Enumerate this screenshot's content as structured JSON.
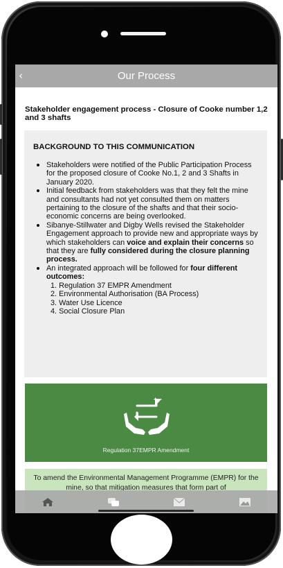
{
  "header": {
    "title": "Our Process",
    "back_glyph": "‹"
  },
  "page_heading": "Stakeholder engagement process - Closure of Cooke number 1,2 and 3 shafts",
  "background": {
    "title": "BACKGROUND TO THIS COMMUNICATION",
    "bullet1": "Stakeholders were notified of the Public Participation Process for the proposed closure of Cooke No.1, 2 and 3 Shafts in January 2020.",
    "bullet2": "Initial feedback from stakeholders was that they felt the mine and consultants had not yet consulted them on matters pertaining to the closure of the shafts and that their socio-economic concerns are being overlooked.",
    "bullet3": {
      "part1": "Sibanye-Stillwater and Digby Wells revised the Stakeholder Engagement approach to provide new and appropriate ways by which stakeholders can ",
      "bold1": "voice and explain their concerns",
      "part2": " so that they are ",
      "bold2": "fully considered during the closure planning process."
    },
    "bullet4": {
      "part1": "An integrated approach will be followed for ",
      "bold1": "four different outcomes:"
    },
    "outcomes": [
      "1.  Regulation 37 EMPR Amendment",
      "2.  Environmental Authorisation (BA Process)",
      "3.  Water Use Licence",
      "4.  Social Closure Plan"
    ]
  },
  "green_card": {
    "caption": "Regulation 37EMPR Amendment",
    "icon": "hands-exchange-icon"
  },
  "light_card": {
    "text": "To amend the Environmental Management Programme (EMPR) for the mine, so that mitigation measures that form part of"
  },
  "tabs": [
    {
      "icon": "home-icon"
    },
    {
      "icon": "chat-icon"
    },
    {
      "icon": "mail-icon"
    },
    {
      "icon": "gallery-icon"
    }
  ],
  "colors": {
    "header": "#a8a8a8",
    "background_box": "#eeeeee",
    "green_card": "#4b8a43",
    "light_card": "#c9e5bd",
    "tab_bar": "#aaaaaa"
  }
}
